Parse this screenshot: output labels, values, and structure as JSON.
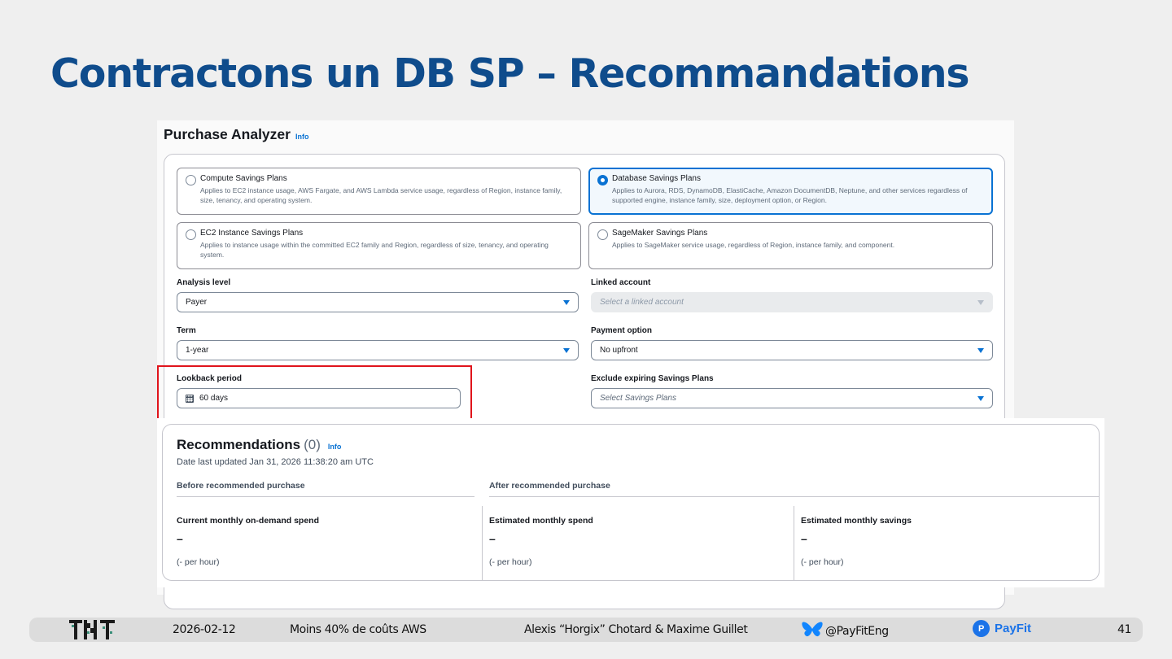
{
  "slide": {
    "title": "Contractons un DB SP – Recommandations"
  },
  "purchase_analyzer": {
    "title": "Purchase Analyzer",
    "info": "Info",
    "plan_types": [
      {
        "title": "Compute Savings Plans",
        "description": "Applies to EC2 instance usage, AWS Fargate, and AWS Lambda service usage, regardless of Region, instance family, size, tenancy, and operating system.",
        "selected": false
      },
      {
        "title": "Database Savings Plans",
        "description": "Applies to Aurora, RDS, DynamoDB, ElastiCache, Amazon DocumentDB, Neptune, and other services regardless of supported engine, instance family, size, deployment option, or Region.",
        "selected": true
      },
      {
        "title": "EC2 Instance Savings Plans",
        "description": "Applies to instance usage within the committed EC2 family and Region, regardless of size, tenancy, and operating system.",
        "selected": false
      },
      {
        "title": "SageMaker Savings Plans",
        "description": "Applies to SageMaker service usage, regardless of Region, instance family, and component.",
        "selected": false
      }
    ],
    "analysis_level": {
      "label": "Analysis level",
      "value": "Payer"
    },
    "linked_account": {
      "label": "Linked account",
      "placeholder": "Select a linked account",
      "disabled": true
    },
    "term": {
      "label": "Term",
      "value": "1-year"
    },
    "payment_option": {
      "label": "Payment option",
      "value": "No upfront"
    },
    "lookback_period": {
      "label": "Lookback period",
      "value": "60 days"
    },
    "exclude_expiring": {
      "label": "Exclude expiring Savings Plans",
      "placeholder": "Select Savings Plans"
    },
    "highlight_color": "#e0141b"
  },
  "recommendations": {
    "title": "Recommendations",
    "count": "(0)",
    "info": "Info",
    "last_updated": "Date last updated Jan 31, 2026 11:38:20 am UTC",
    "before_group": "Before recommended purchase",
    "after_group": "After recommended purchase",
    "metrics": [
      {
        "label": "Current monthly on-demand spend",
        "value": "–",
        "sub": "(- per hour)"
      },
      {
        "label": "Estimated monthly spend",
        "value": "–",
        "sub": "(- per hour)"
      },
      {
        "label": "Estimated monthly savings",
        "value": "–",
        "sub": "(- per hour)"
      }
    ]
  },
  "footer": {
    "date": "2026-02-12",
    "talk_title": "Moins 40% de coûts AWS",
    "authors": "Alexis “Horgix” Chotard & Maxime Guillet",
    "social_handle": "@PayFitEng",
    "social_icon": "bluesky-butterfly-icon",
    "company_logo_text": "PayFit",
    "page_number": "41"
  },
  "colors": {
    "title_blue": "#0f4c8c",
    "aws_blue": "#0972d3",
    "footer_bg": "#dcdcdc",
    "payfit_blue": "#1b73e8"
  }
}
